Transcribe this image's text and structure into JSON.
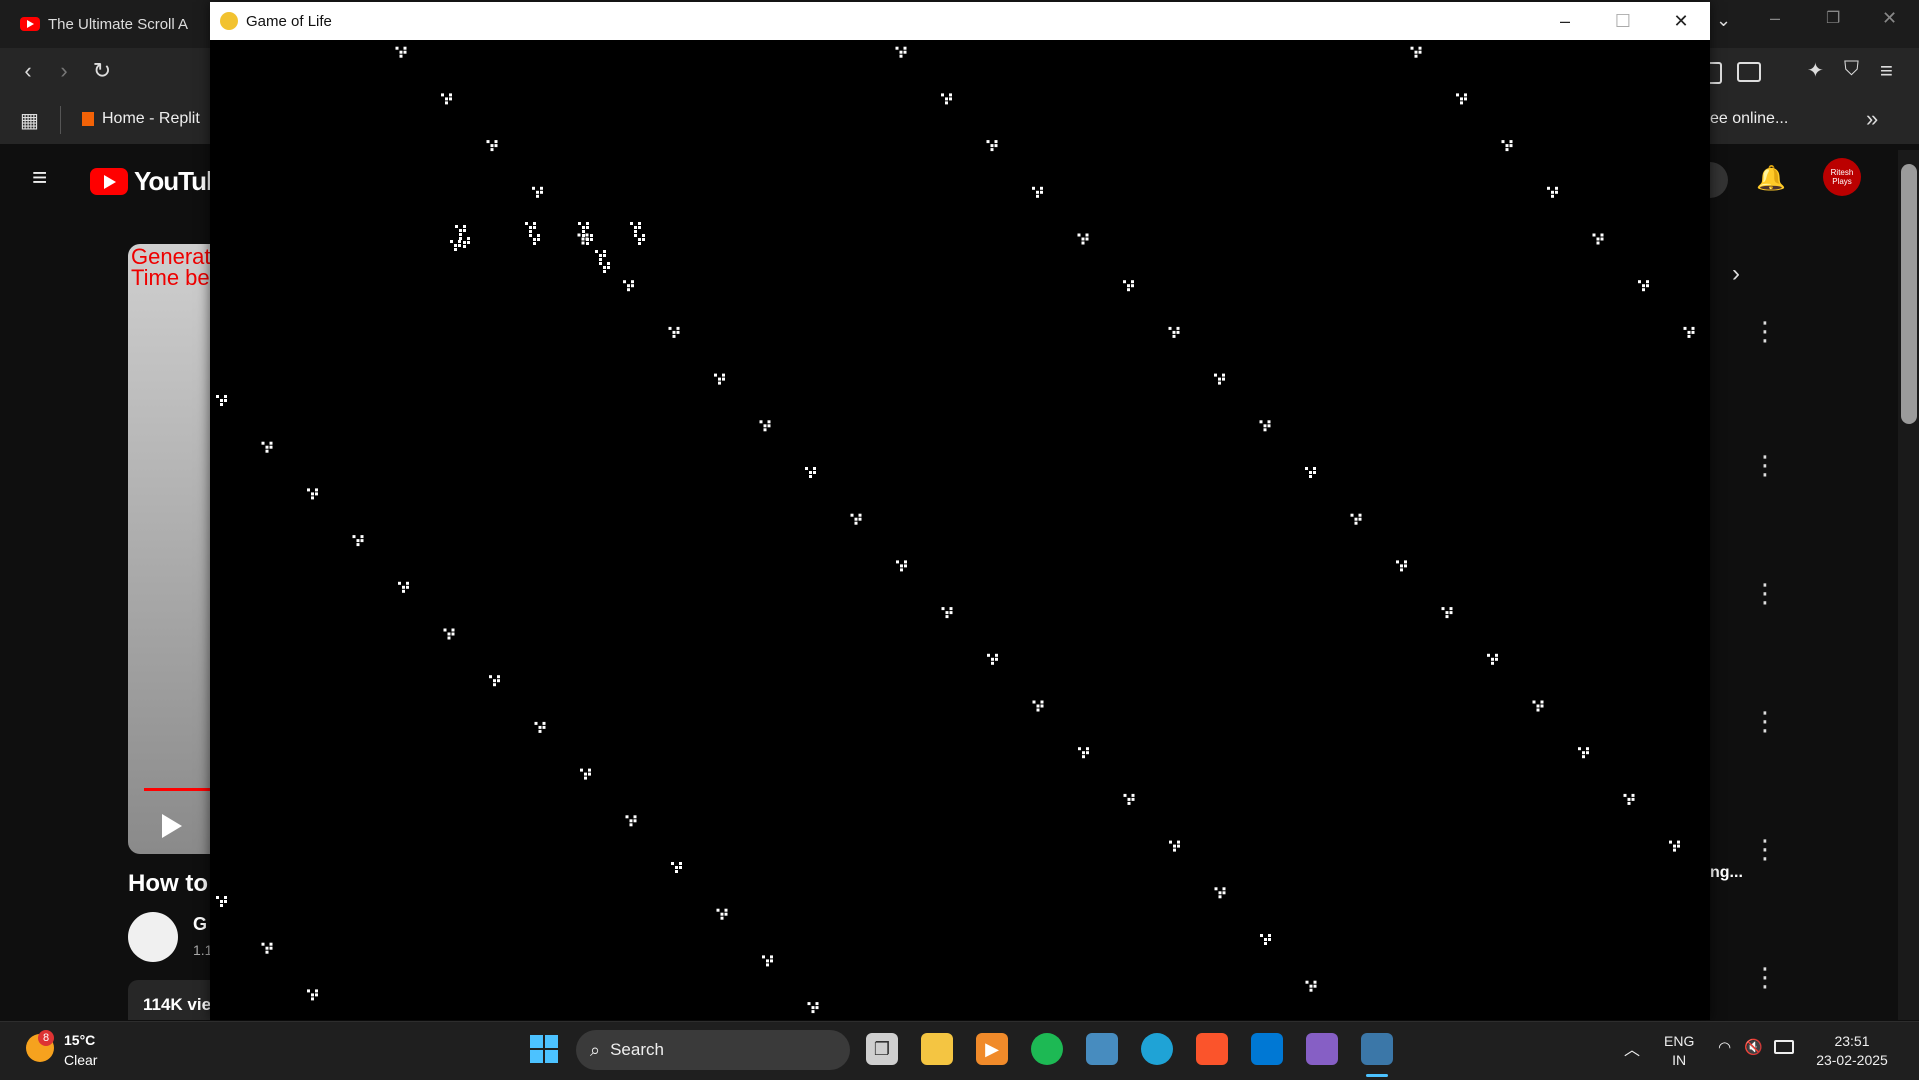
{
  "browser": {
    "tab_title": "The Ultimate Scroll A",
    "bookmark": "Home - Replit",
    "bookmark_right": "ee online..."
  },
  "youtube": {
    "logo_text": "YouTube",
    "player_overlay_line1": "Generat",
    "player_overlay_line2": "Time be",
    "video_title": "How to",
    "channel_initial": "G",
    "channel_sub": "1.1",
    "views": "114K vie",
    "right_snippet": "ng...",
    "avatar_text": "Ritesh Plays"
  },
  "game_window": {
    "title": "Game of Life",
    "minimize": "–",
    "maximize": "☐",
    "close": "✕"
  },
  "taskbar": {
    "weather_badge": "8",
    "temperature": "15°C",
    "condition": "Clear",
    "search_placeholder": "Search",
    "language_top": "ENG",
    "language_bottom": "IN",
    "time": "23:51",
    "date": "23-02-2025"
  },
  "colors": {
    "game_bg": "#000000",
    "cell": "#ffffff",
    "youtube_red": "#ff0000",
    "taskbar_bg": "#1f1f1f"
  }
}
